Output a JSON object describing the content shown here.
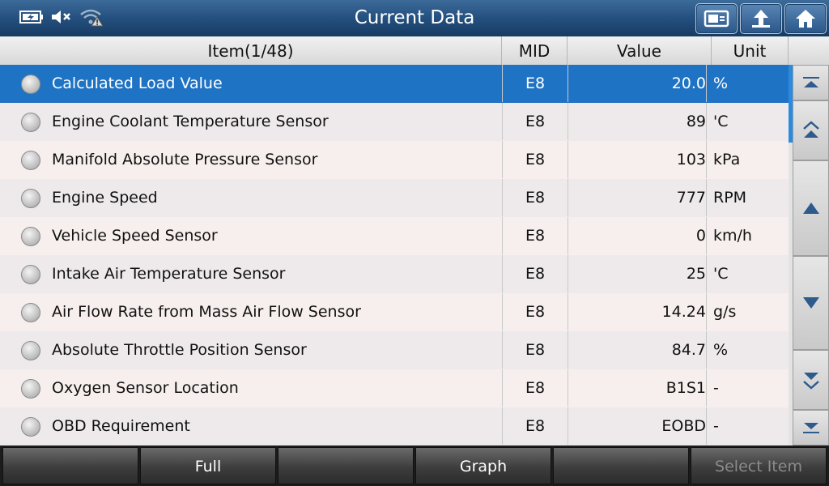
{
  "header": {
    "title": "Current Data",
    "status_icons": [
      "battery-charging-icon",
      "speaker-muted-icon",
      "wifi-warning-icon"
    ],
    "buttons": [
      "screenshot-icon",
      "back-icon",
      "home-icon"
    ]
  },
  "table": {
    "columns": {
      "item": "Item(1/48)",
      "mid": "MID",
      "value": "Value",
      "unit": "Unit"
    },
    "rows": [
      {
        "item": "Calculated Load Value",
        "mid": "E8",
        "value": "20.0",
        "unit": "%"
      },
      {
        "item": "Engine Coolant Temperature Sensor",
        "mid": "E8",
        "value": "89",
        "unit": "'C"
      },
      {
        "item": "Manifold Absolute Pressure Sensor",
        "mid": "E8",
        "value": "103",
        "unit": "kPa"
      },
      {
        "item": "Engine Speed",
        "mid": "E8",
        "value": "777",
        "unit": "RPM"
      },
      {
        "item": "Vehicle Speed Sensor",
        "mid": "E8",
        "value": "0",
        "unit": "km/h"
      },
      {
        "item": "Intake Air Temperature Sensor",
        "mid": "E8",
        "value": "25",
        "unit": "'C"
      },
      {
        "item": "Air Flow Rate from Mass Air Flow Sensor",
        "mid": "E8",
        "value": "14.24",
        "unit": "g/s"
      },
      {
        "item": "Absolute Throttle Position Sensor",
        "mid": "E8",
        "value": "84.7",
        "unit": "%"
      },
      {
        "item": "Oxygen Sensor Location",
        "mid": "E8",
        "value": "B1S1",
        "unit": "-"
      },
      {
        "item": "OBD Requirement",
        "mid": "E8",
        "value": "EOBD",
        "unit": "-"
      }
    ]
  },
  "footer": {
    "buttons": [
      "",
      "Full",
      "",
      "Graph",
      "",
      "Select Item"
    ]
  },
  "colors": {
    "accent": "#1f73c4",
    "titlebar": "#24507f"
  }
}
